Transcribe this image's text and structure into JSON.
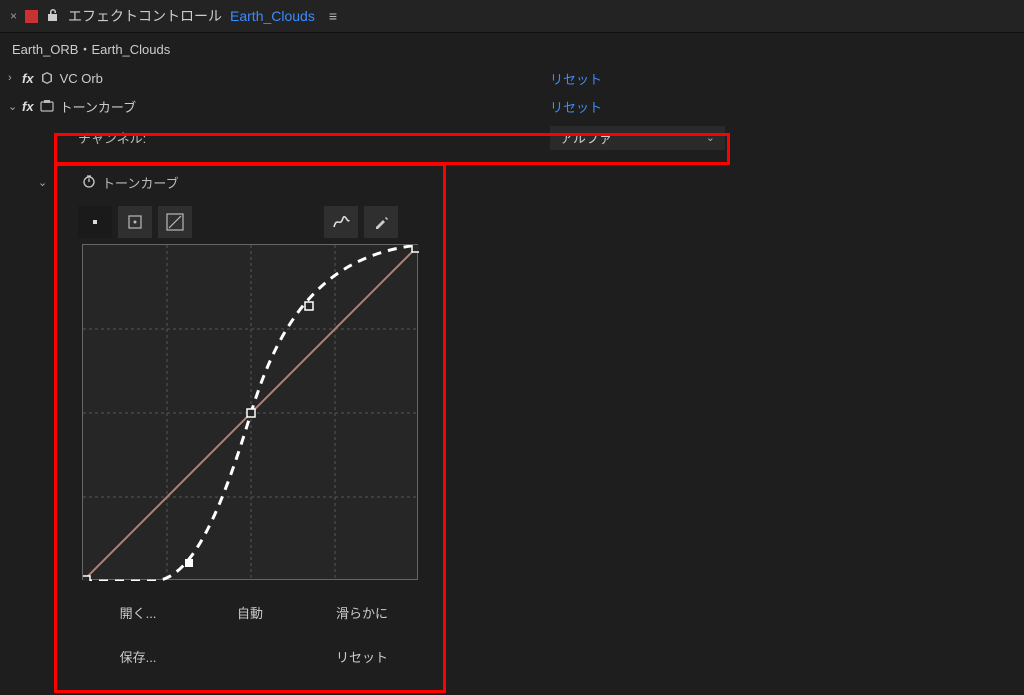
{
  "header": {
    "panel_title": "エフェクトコントロール",
    "layer_name": "Earth_Clouds",
    "breadcrumb": "Earth_ORB・Earth_Clouds"
  },
  "effects": {
    "vc_orb": {
      "name": "VC Orb",
      "reset": "リセット"
    },
    "curves": {
      "name": "トーンカーブ",
      "reset": "リセット"
    }
  },
  "channel": {
    "label": "チャンネル:",
    "value": "アルファ"
  },
  "curves_prop_label": "トーンカーブ",
  "buttons": {
    "open": "開く...",
    "auto": "自動",
    "smooth": "滑らかに",
    "save": "保存...",
    "reset": "リセット"
  },
  "icons": {
    "close": "close-icon",
    "lock": "lock-icon",
    "menu": "menu-icon",
    "cube": "cube-icon",
    "preset": "preset-icon",
    "stopwatch": "stopwatch-icon",
    "curve_mode_point": "point-mode-icon",
    "curve_mode_linear": "linear-mode-icon",
    "curve_mode_free": "free-mode-icon",
    "pencil": "pencil-icon",
    "smooth_tool": "smooth-tool-icon"
  }
}
